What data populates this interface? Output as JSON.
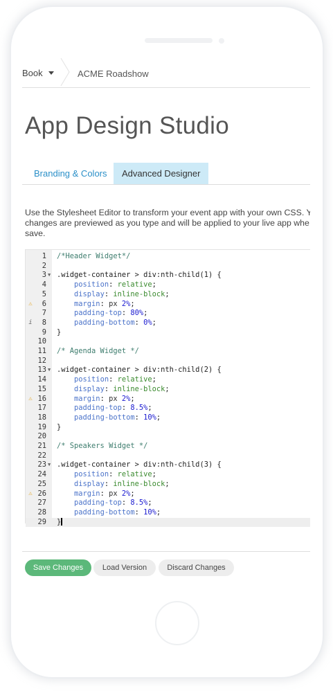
{
  "breadcrumb": {
    "book_label": "Book",
    "event_label": "ACME Roadshow"
  },
  "page_title": "App Design Studio",
  "tabs": [
    {
      "label": "Branding & Colors",
      "active": false
    },
    {
      "label": "Advanced Designer",
      "active": true
    }
  ],
  "description": {
    "line1": "Use the Stylesheet Editor to transform your event app with your own CSS. Y",
    "line2": "changes are previewed as you type and will be applied to your live app whe",
    "line3": "save."
  },
  "editor": {
    "lines": [
      {
        "num": "1",
        "code": "/*Header Widget*/"
      },
      {
        "num": "2",
        "code": ""
      },
      {
        "num": "3",
        "code": ".widget-container > div:nth-child(1) {"
      },
      {
        "num": "4",
        "code": "    position: relative;"
      },
      {
        "num": "5",
        "code": "    display: inline-block;"
      },
      {
        "num": "6",
        "code": "    margin: px 2%;"
      },
      {
        "num": "7",
        "code": "    padding-top: 80%;"
      },
      {
        "num": "8",
        "code": "    padding-bottom: 0%;"
      },
      {
        "num": "9",
        "code": "}"
      },
      {
        "num": "10",
        "code": ""
      },
      {
        "num": "11",
        "code": "/* Agenda Widget */"
      },
      {
        "num": "12",
        "code": ""
      },
      {
        "num": "13",
        "code": ".widget-container > div:nth-child(2) {"
      },
      {
        "num": "14",
        "code": "    position: relative;"
      },
      {
        "num": "15",
        "code": "    display: inline-block;"
      },
      {
        "num": "16",
        "code": "    margin: px 2%;"
      },
      {
        "num": "17",
        "code": "    padding-top: 8.5%;"
      },
      {
        "num": "18",
        "code": "    padding-bottom: 10%;"
      },
      {
        "num": "19",
        "code": "}"
      },
      {
        "num": "20",
        "code": ""
      },
      {
        "num": "21",
        "code": "/* Speakers Widget */"
      },
      {
        "num": "22",
        "code": ""
      },
      {
        "num": "23",
        "code": ".widget-container > div:nth-child(3) {"
      },
      {
        "num": "24",
        "code": "    position: relative;"
      },
      {
        "num": "25",
        "code": "    display: inline-block;"
      },
      {
        "num": "26",
        "code": "    margin: px 2%;"
      },
      {
        "num": "27",
        "code": "    padding-top: 8.5%;"
      },
      {
        "num": "28",
        "code": "    padding-bottom: 10%;"
      },
      {
        "num": "29",
        "code": "}"
      }
    ],
    "warning_lines": [
      "6",
      "16",
      "26"
    ],
    "info_lines": [
      "8"
    ],
    "fold_lines": [
      "3",
      "13",
      "23"
    ],
    "active_line": "29",
    "icons": {
      "warning": "warning-icon",
      "info": "info-icon",
      "fold": "fold-arrow-icon"
    }
  },
  "actions": {
    "save_label": "Save Changes",
    "load_label": "Load Version",
    "discard_label": "Discard Changes"
  },
  "colors": {
    "accent_blue": "#2a8fc8",
    "active_tab_bg": "#cdeaf7",
    "save_green": "#5cb87a",
    "warning": "#e3a21a"
  }
}
